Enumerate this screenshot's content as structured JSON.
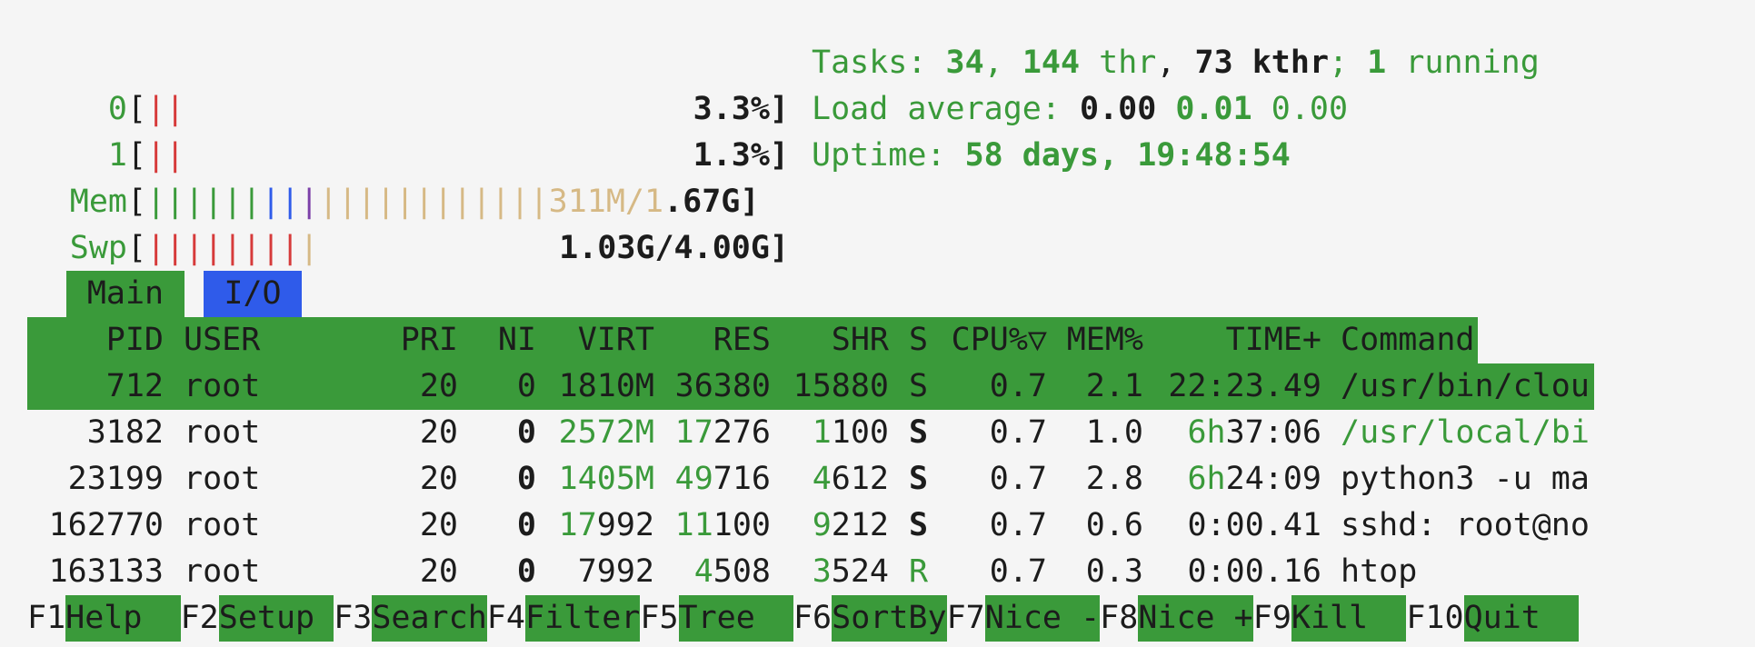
{
  "meters": {
    "cpu0": {
      "label": "0",
      "bar_segments": [
        "r",
        "r"
      ],
      "value": "3.3%"
    },
    "cpu1": {
      "label": "1",
      "bar_segments": [
        "r",
        "r"
      ],
      "value": "1.3%"
    },
    "mem": {
      "label": "Mem",
      "value_prefix": "311M/1",
      "value_suffix": ".67G"
    },
    "swp": {
      "label": "Swp",
      "value": "1.03G/4.00G"
    }
  },
  "info": {
    "tasks_label": "Tasks: ",
    "tasks_count": "34",
    "tasks_sep1": ", ",
    "threads": "144",
    "threads_label": " thr",
    "tasks_sep2": ", ",
    "kthreads": "73",
    "kthreads_label": " kthr",
    "running_sep": "; ",
    "running": "1",
    "running_label": " running",
    "load_label": "Load average: ",
    "load1": "0.00",
    "load5": "0.01",
    "load15": "0.00",
    "uptime_label": "Uptime: ",
    "uptime": "58 days, 19:48:54"
  },
  "tabs": [
    {
      "label": "Main"
    },
    {
      "label": "I/O"
    }
  ],
  "header": {
    "pid": "PID",
    "user": "USER",
    "pri": "PRI",
    "ni": "NI",
    "virt": "VIRT",
    "res": "RES",
    "shr": "SHR",
    "s": "S",
    "cpu": "CPU%▽",
    "mem": "MEM%",
    "time": "TIME+",
    "cmd": "Command"
  },
  "processes": [
    {
      "pid": "712",
      "user": "root",
      "pri": "20",
      "ni": "0",
      "virt": "1810M",
      "res": "36380",
      "shr": "15880",
      "s": "S",
      "cpu": "0.7",
      "mem": "2.1",
      "time": "22:23.49",
      "cmd": "/usr/bin/clou"
    },
    {
      "pid": "3182",
      "user": "root",
      "pri": "20",
      "ni": "0",
      "virt_hi": "2572M",
      "virt_lo": "",
      "res_hi": "17",
      "res_lo": "276",
      "shr_hi": "1",
      "shr_lo": "100",
      "s": "S",
      "cpu": "0.7",
      "mem": "1.0",
      "time_hi": "6h",
      "time_lo": "37:06",
      "cmd": "/usr/local/bi"
    },
    {
      "pid": "23199",
      "user": "root",
      "pri": "20",
      "ni": "0",
      "virt_hi": "1405M",
      "virt_lo": "",
      "res_hi": "49",
      "res_lo": "716",
      "shr_hi": "4",
      "shr_lo": "612",
      "s": "S",
      "cpu": "0.7",
      "mem": "2.8",
      "time_hi": "6h",
      "time_lo": "24:09",
      "cmd": "python3 -u ma"
    },
    {
      "pid": "162770",
      "user": "root",
      "pri": "20",
      "ni": "0",
      "virt_hi": "17",
      "virt_lo": "992",
      "res_hi": "11",
      "res_lo": "100",
      "shr_hi": "9",
      "shr_lo": "212",
      "s": "S",
      "cpu": "0.7",
      "mem": "0.6",
      "time_hi": "",
      "time_lo": "0:00.41",
      "cmd": "sshd: root@no"
    },
    {
      "pid": "163133",
      "user": "root",
      "pri": "20",
      "ni": "0",
      "virt_hi": "",
      "virt_lo": "7992",
      "res_hi": "4",
      "res_lo": "508",
      "shr_hi": "3",
      "shr_lo": "524",
      "s": "R",
      "cpu": "0.7",
      "mem": "0.3",
      "time_hi": "",
      "time_lo": "0:00.16",
      "cmd": "htop"
    }
  ],
  "function_keys": [
    {
      "key": "F1",
      "label": "Help  "
    },
    {
      "key": "F2",
      "label": "Setup "
    },
    {
      "key": "F3",
      "label": "Search"
    },
    {
      "key": "F4",
      "label": "Filter"
    },
    {
      "key": "F5",
      "label": "Tree  "
    },
    {
      "key": "F6",
      "label": "SortBy"
    },
    {
      "key": "F7",
      "label": "Nice -"
    },
    {
      "key": "F8",
      "label": "Nice +"
    },
    {
      "key": "F9",
      "label": "Kill  "
    },
    {
      "key": "F10",
      "label": "Quit  "
    }
  ],
  "colors": {
    "green": "#3a9a3a",
    "red": "#d63a3a",
    "blue": "#2f5bea",
    "purple": "#7b3fa8",
    "tan": "#d6b985",
    "background": "#f5f5f5"
  }
}
